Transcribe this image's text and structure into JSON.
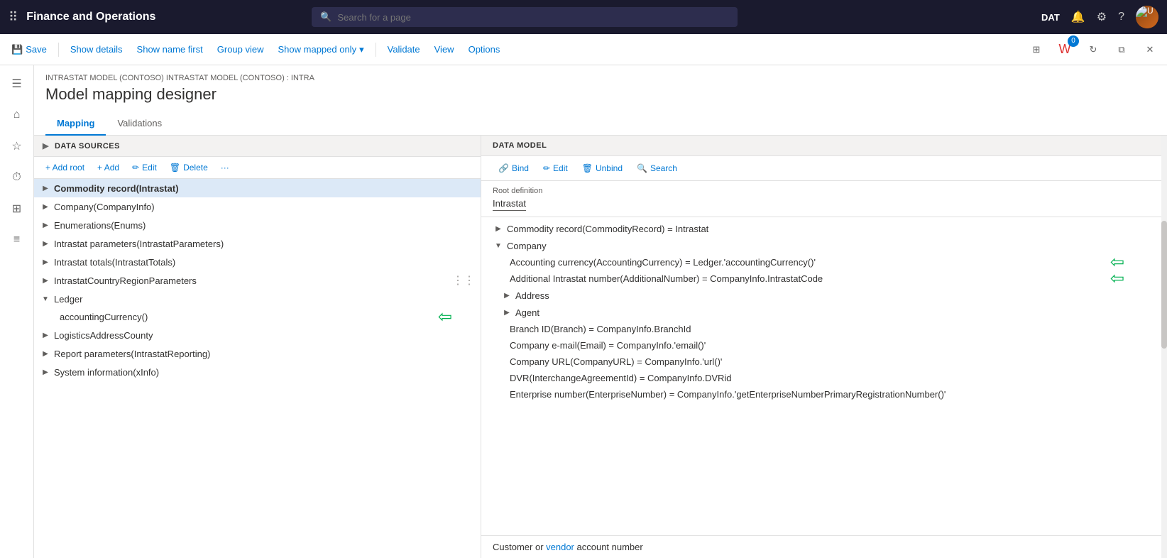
{
  "topnav": {
    "app_title": "Finance and Operations",
    "search_placeholder": "Search for a page",
    "env_tag": "DAT",
    "notification_icon": "🔔",
    "settings_icon": "⚙",
    "help_icon": "?",
    "grid_icon": "⠿"
  },
  "toolbar": {
    "save_label": "Save",
    "show_details_label": "Show details",
    "show_name_first_label": "Show name first",
    "group_view_label": "Group view",
    "show_mapped_only_label": "Show mapped only",
    "validate_label": "Validate",
    "view_label": "View",
    "options_label": "Options"
  },
  "page": {
    "breadcrumb": "INTRASTAT MODEL (CONTOSO) INTRASTAT MODEL (CONTOSO) : INTRA",
    "title": "Model mapping designer",
    "tabs": [
      {
        "label": "Mapping",
        "active": true
      },
      {
        "label": "Validations",
        "active": false
      }
    ]
  },
  "data_sources": {
    "panel_title": "DATA SOURCES",
    "toolbar": {
      "add_root": "+ Add root",
      "add": "+ Add",
      "edit": "✏ Edit",
      "delete": "🗑 Delete",
      "more": "···"
    },
    "items": [
      {
        "id": "commodity",
        "label": "Commodity record(Intrastat)",
        "indent": 0,
        "expanded": false,
        "selected": true
      },
      {
        "id": "company",
        "label": "Company(CompanyInfo)",
        "indent": 0,
        "expanded": false,
        "selected": false
      },
      {
        "id": "enumerations",
        "label": "Enumerations(Enums)",
        "indent": 0,
        "expanded": false,
        "selected": false
      },
      {
        "id": "intrastat_params",
        "label": "Intrastat parameters(IntrastatParameters)",
        "indent": 0,
        "expanded": false,
        "selected": false
      },
      {
        "id": "intrastat_totals",
        "label": "Intrastat totals(IntrastatTotals)",
        "indent": 0,
        "expanded": false,
        "selected": false
      },
      {
        "id": "country_region",
        "label": "IntrastatCountryRegionParameters",
        "indent": 0,
        "expanded": false,
        "selected": false
      },
      {
        "id": "ledger",
        "label": "Ledger",
        "indent": 0,
        "expanded": true,
        "selected": false
      },
      {
        "id": "accounting_currency",
        "label": "accountingCurrency()",
        "indent": 1,
        "expanded": false,
        "selected": false,
        "has_green_arrow": true
      },
      {
        "id": "logistics",
        "label": "LogisticsAddressCounty",
        "indent": 0,
        "expanded": false,
        "selected": false
      },
      {
        "id": "report_params",
        "label": "Report parameters(IntrastatReporting)",
        "indent": 0,
        "expanded": false,
        "selected": false
      },
      {
        "id": "system_info",
        "label": "System information(xInfo)",
        "indent": 0,
        "expanded": false,
        "selected": false
      }
    ]
  },
  "data_model": {
    "panel_title": "DATA MODEL",
    "toolbar": {
      "bind_label": "Bind",
      "edit_label": "Edit",
      "unbind_label": "Unbind",
      "search_label": "Search"
    },
    "root_definition": {
      "label": "Root definition",
      "value": "Intrastat"
    },
    "items": [
      {
        "id": "commodity_record",
        "label": "Commodity record(CommodityRecord) = Intrastat",
        "indent": 0,
        "expanded": false
      },
      {
        "id": "company_node",
        "label": "Company",
        "indent": 0,
        "expanded": true
      },
      {
        "id": "accounting_currency_node",
        "label": "Accounting currency(AccountingCurrency) = Ledger.'accountingCurrency()'",
        "indent": 2,
        "has_green_arrow": true
      },
      {
        "id": "additional_number",
        "label": "Additional Intrastat number(AdditionalNumber) = CompanyInfo.IntrastatCode",
        "indent": 2,
        "has_green_arrow": true
      },
      {
        "id": "address_node",
        "label": "Address",
        "indent": 1,
        "expanded": false
      },
      {
        "id": "agent_node",
        "label": "Agent",
        "indent": 1,
        "expanded": false
      },
      {
        "id": "branch_id",
        "label": "Branch ID(Branch) = CompanyInfo.BranchId",
        "indent": 2
      },
      {
        "id": "company_email",
        "label": "Company e-mail(Email) = CompanyInfo.'email()'",
        "indent": 2
      },
      {
        "id": "company_url",
        "label": "Company URL(CompanyURL) = CompanyInfo.'url()'",
        "indent": 2
      },
      {
        "id": "dvr",
        "label": "DVR(InterchangeAgreementId) = CompanyInfo.DVRid",
        "indent": 2
      },
      {
        "id": "enterprise_number",
        "label": "Enterprise number(EnterpriseNumber) = CompanyInfo.'getEnterpriseNumberPrimaryRegistrationNumber()'",
        "indent": 2
      }
    ],
    "bottom_label": "Customer or vendor account number"
  }
}
